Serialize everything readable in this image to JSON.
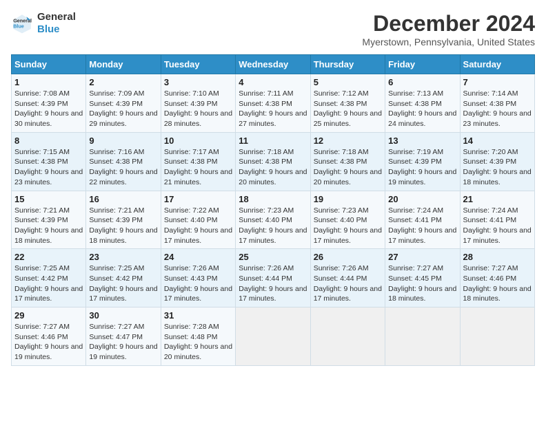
{
  "logo": {
    "name_part1": "General",
    "name_part2": "Blue"
  },
  "title": "December 2024",
  "subtitle": "Myerstown, Pennsylvania, United States",
  "headers": [
    "Sunday",
    "Monday",
    "Tuesday",
    "Wednesday",
    "Thursday",
    "Friday",
    "Saturday"
  ],
  "weeks": [
    [
      {
        "day": "1",
        "sunrise": "7:08 AM",
        "sunset": "4:39 PM",
        "daylight": "9 hours and 30 minutes."
      },
      {
        "day": "2",
        "sunrise": "7:09 AM",
        "sunset": "4:39 PM",
        "daylight": "9 hours and 29 minutes."
      },
      {
        "day": "3",
        "sunrise": "7:10 AM",
        "sunset": "4:39 PM",
        "daylight": "9 hours and 28 minutes."
      },
      {
        "day": "4",
        "sunrise": "7:11 AM",
        "sunset": "4:38 PM",
        "daylight": "9 hours and 27 minutes."
      },
      {
        "day": "5",
        "sunrise": "7:12 AM",
        "sunset": "4:38 PM",
        "daylight": "9 hours and 25 minutes."
      },
      {
        "day": "6",
        "sunrise": "7:13 AM",
        "sunset": "4:38 PM",
        "daylight": "9 hours and 24 minutes."
      },
      {
        "day": "7",
        "sunrise": "7:14 AM",
        "sunset": "4:38 PM",
        "daylight": "9 hours and 23 minutes."
      }
    ],
    [
      {
        "day": "8",
        "sunrise": "7:15 AM",
        "sunset": "4:38 PM",
        "daylight": "9 hours and 23 minutes."
      },
      {
        "day": "9",
        "sunrise": "7:16 AM",
        "sunset": "4:38 PM",
        "daylight": "9 hours and 22 minutes."
      },
      {
        "day": "10",
        "sunrise": "7:17 AM",
        "sunset": "4:38 PM",
        "daylight": "9 hours and 21 minutes."
      },
      {
        "day": "11",
        "sunrise": "7:18 AM",
        "sunset": "4:38 PM",
        "daylight": "9 hours and 20 minutes."
      },
      {
        "day": "12",
        "sunrise": "7:18 AM",
        "sunset": "4:38 PM",
        "daylight": "9 hours and 20 minutes."
      },
      {
        "day": "13",
        "sunrise": "7:19 AM",
        "sunset": "4:39 PM",
        "daylight": "9 hours and 19 minutes."
      },
      {
        "day": "14",
        "sunrise": "7:20 AM",
        "sunset": "4:39 PM",
        "daylight": "9 hours and 18 minutes."
      }
    ],
    [
      {
        "day": "15",
        "sunrise": "7:21 AM",
        "sunset": "4:39 PM",
        "daylight": "9 hours and 18 minutes."
      },
      {
        "day": "16",
        "sunrise": "7:21 AM",
        "sunset": "4:39 PM",
        "daylight": "9 hours and 18 minutes."
      },
      {
        "day": "17",
        "sunrise": "7:22 AM",
        "sunset": "4:40 PM",
        "daylight": "9 hours and 17 minutes."
      },
      {
        "day": "18",
        "sunrise": "7:23 AM",
        "sunset": "4:40 PM",
        "daylight": "9 hours and 17 minutes."
      },
      {
        "day": "19",
        "sunrise": "7:23 AM",
        "sunset": "4:40 PM",
        "daylight": "9 hours and 17 minutes."
      },
      {
        "day": "20",
        "sunrise": "7:24 AM",
        "sunset": "4:41 PM",
        "daylight": "9 hours and 17 minutes."
      },
      {
        "day": "21",
        "sunrise": "7:24 AM",
        "sunset": "4:41 PM",
        "daylight": "9 hours and 17 minutes."
      }
    ],
    [
      {
        "day": "22",
        "sunrise": "7:25 AM",
        "sunset": "4:42 PM",
        "daylight": "9 hours and 17 minutes."
      },
      {
        "day": "23",
        "sunrise": "7:25 AM",
        "sunset": "4:42 PM",
        "daylight": "9 hours and 17 minutes."
      },
      {
        "day": "24",
        "sunrise": "7:26 AM",
        "sunset": "4:43 PM",
        "daylight": "9 hours and 17 minutes."
      },
      {
        "day": "25",
        "sunrise": "7:26 AM",
        "sunset": "4:44 PM",
        "daylight": "9 hours and 17 minutes."
      },
      {
        "day": "26",
        "sunrise": "7:26 AM",
        "sunset": "4:44 PM",
        "daylight": "9 hours and 17 minutes."
      },
      {
        "day": "27",
        "sunrise": "7:27 AM",
        "sunset": "4:45 PM",
        "daylight": "9 hours and 18 minutes."
      },
      {
        "day": "28",
        "sunrise": "7:27 AM",
        "sunset": "4:46 PM",
        "daylight": "9 hours and 18 minutes."
      }
    ],
    [
      {
        "day": "29",
        "sunrise": "7:27 AM",
        "sunset": "4:46 PM",
        "daylight": "9 hours and 19 minutes."
      },
      {
        "day": "30",
        "sunrise": "7:27 AM",
        "sunset": "4:47 PM",
        "daylight": "9 hours and 19 minutes."
      },
      {
        "day": "31",
        "sunrise": "7:28 AM",
        "sunset": "4:48 PM",
        "daylight": "9 hours and 20 minutes."
      },
      null,
      null,
      null,
      null
    ]
  ]
}
